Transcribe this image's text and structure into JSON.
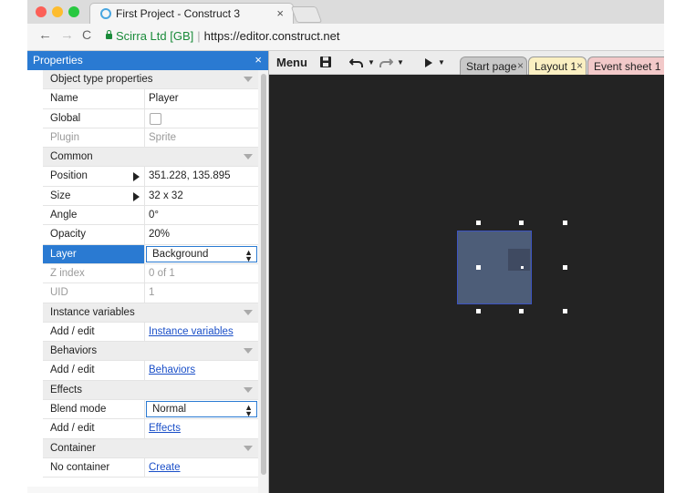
{
  "browser": {
    "tab_title": "First Project - Construct 3",
    "tab_close": "×",
    "back": "←",
    "forward": "→",
    "reload": "C",
    "security_label": "Scirra Ltd [GB]",
    "separator": "|",
    "url": "https://editor.construct.net"
  },
  "properties": {
    "title": "Properties",
    "close": "×",
    "rows": [
      {
        "type": "section",
        "label": "Object type properties"
      },
      {
        "type": "prop",
        "label": "Name",
        "value": "Player"
      },
      {
        "type": "checkbox",
        "label": "Global",
        "value": ""
      },
      {
        "type": "prop",
        "label": "Plugin",
        "value": "Sprite",
        "disabled": true
      },
      {
        "type": "section",
        "label": "Common"
      },
      {
        "type": "prop",
        "label": "Position",
        "value": "351.228, 135.895",
        "expander": true
      },
      {
        "type": "prop",
        "label": "Size",
        "value": "32 x 32",
        "expander": true
      },
      {
        "type": "prop",
        "label": "Angle",
        "value": "0°"
      },
      {
        "type": "prop",
        "label": "Opacity",
        "value": "20%"
      },
      {
        "type": "select",
        "label": "Layer",
        "value": "Background",
        "selected": true
      },
      {
        "type": "prop",
        "label": "Z index",
        "value": "0 of 1",
        "disabled": true
      },
      {
        "type": "prop",
        "label": "UID",
        "value": "1",
        "disabled": true
      },
      {
        "type": "section",
        "label": "Instance variables"
      },
      {
        "type": "link",
        "label": "Add / edit",
        "value": "Instance variables"
      },
      {
        "type": "section",
        "label": "Behaviors"
      },
      {
        "type": "link",
        "label": "Add / edit",
        "value": "Behaviors"
      },
      {
        "type": "section",
        "label": "Effects"
      },
      {
        "type": "select",
        "label": "Blend mode",
        "value": "Normal"
      },
      {
        "type": "link",
        "label": "Add / edit",
        "value": "Effects"
      },
      {
        "type": "section",
        "label": "Container"
      },
      {
        "type": "link",
        "label": "No container",
        "value": "Create"
      }
    ]
  },
  "toolbar": {
    "menu_label": "Menu",
    "save_icon": "save-icon",
    "undo_icon": "undo-icon",
    "redo_icon": "redo-icon",
    "play_icon": "play-icon",
    "tabs": [
      {
        "label": "Start page",
        "close": "×"
      },
      {
        "label": "Layout 1",
        "close": "×"
      },
      {
        "label": "Event sheet 1",
        "close": ""
      }
    ]
  },
  "colors": {
    "accent": "#2a7ad2",
    "canvas_bg": "#232323",
    "sprite_fill": "#4d5d78",
    "layout_tab": "#fbf0c2",
    "event_tab": "#f2c9c9"
  }
}
